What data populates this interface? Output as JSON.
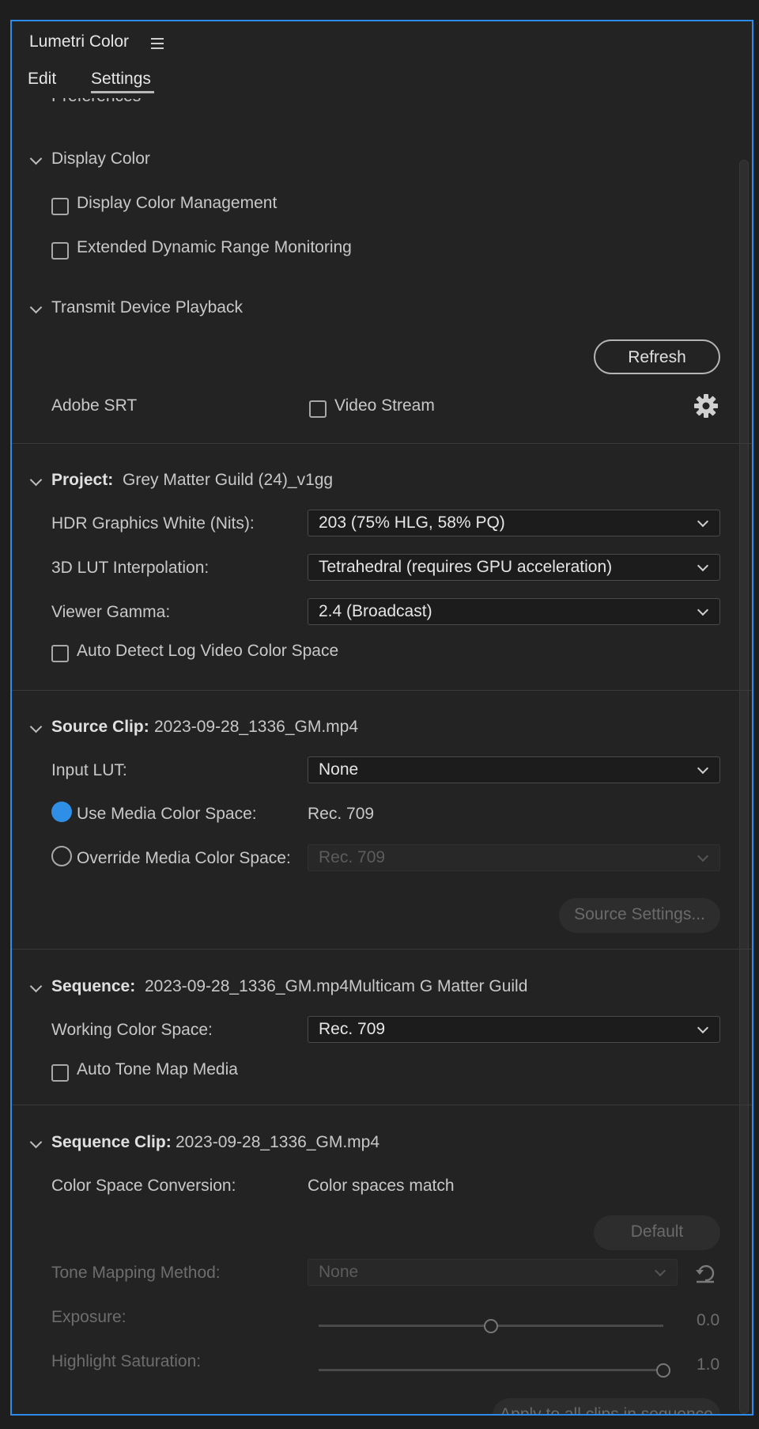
{
  "panel": {
    "title": "Lumetri Color"
  },
  "tabs": [
    {
      "label": "Edit"
    },
    {
      "label": "Settings"
    }
  ],
  "preferences_heading": "Preferences",
  "display_color": {
    "heading": "Display Color",
    "display_color_management": "Display Color Management",
    "extended_dynamic_range": "Extended Dynamic Range Monitoring"
  },
  "transmit": {
    "heading": "Transmit Device Playback",
    "refresh_label": "Refresh",
    "adobe_srt_label": "Adobe SRT",
    "video_stream_label": "Video Stream"
  },
  "project": {
    "heading_label": "Project:",
    "name": "Grey Matter Guild (24)_v1gg",
    "hdr_white_label": "HDR Graphics White (Nits):",
    "hdr_white_value": "203 (75% HLG, 58% PQ)",
    "lut_interp_label": "3D LUT Interpolation:",
    "lut_interp_value": "Tetrahedral (requires GPU acceleration)",
    "viewer_gamma_label": "Viewer Gamma:",
    "viewer_gamma_value": "2.4 (Broadcast)",
    "auto_detect_log": "Auto Detect Log Video Color Space"
  },
  "source_clip": {
    "heading_label": "Source Clip:",
    "name": "2023-09-28_1336_GM.mp4",
    "input_lut_label": "Input LUT:",
    "input_lut_value": "None",
    "use_media_label": "Use Media Color Space:",
    "use_media_value": "Rec. 709",
    "override_label": "Override Media Color Space:",
    "override_value": "Rec. 709",
    "source_settings_label": "Source Settings..."
  },
  "sequence": {
    "heading_label": "Sequence:",
    "name": "2023-09-28_1336_GM.mp4Multicam G Matter Guild",
    "working_space_label": "Working Color Space:",
    "working_space_value": "Rec. 709",
    "auto_tone_map": "Auto Tone Map Media"
  },
  "sequence_clip": {
    "heading_label": "Sequence Clip:",
    "name": "2023-09-28_1336_GM.mp4",
    "conversion_label": "Color Space Conversion:",
    "conversion_value": "Color spaces match",
    "default_label": "Default",
    "tone_method_label": "Tone Mapping Method:",
    "tone_method_value": "None",
    "exposure_label": "Exposure:",
    "exposure_value": "0.0",
    "exposure_fraction": 0.5,
    "highlight_sat_label": "Highlight Saturation:",
    "highlight_sat_value": "1.0",
    "highlight_sat_fraction": 1.0,
    "apply_all_label": "Apply to all clips in sequence"
  },
  "colors": {
    "accent": "#2d8ceb",
    "radio_on": "#2f8fe6",
    "panel_bg": "#232323"
  }
}
